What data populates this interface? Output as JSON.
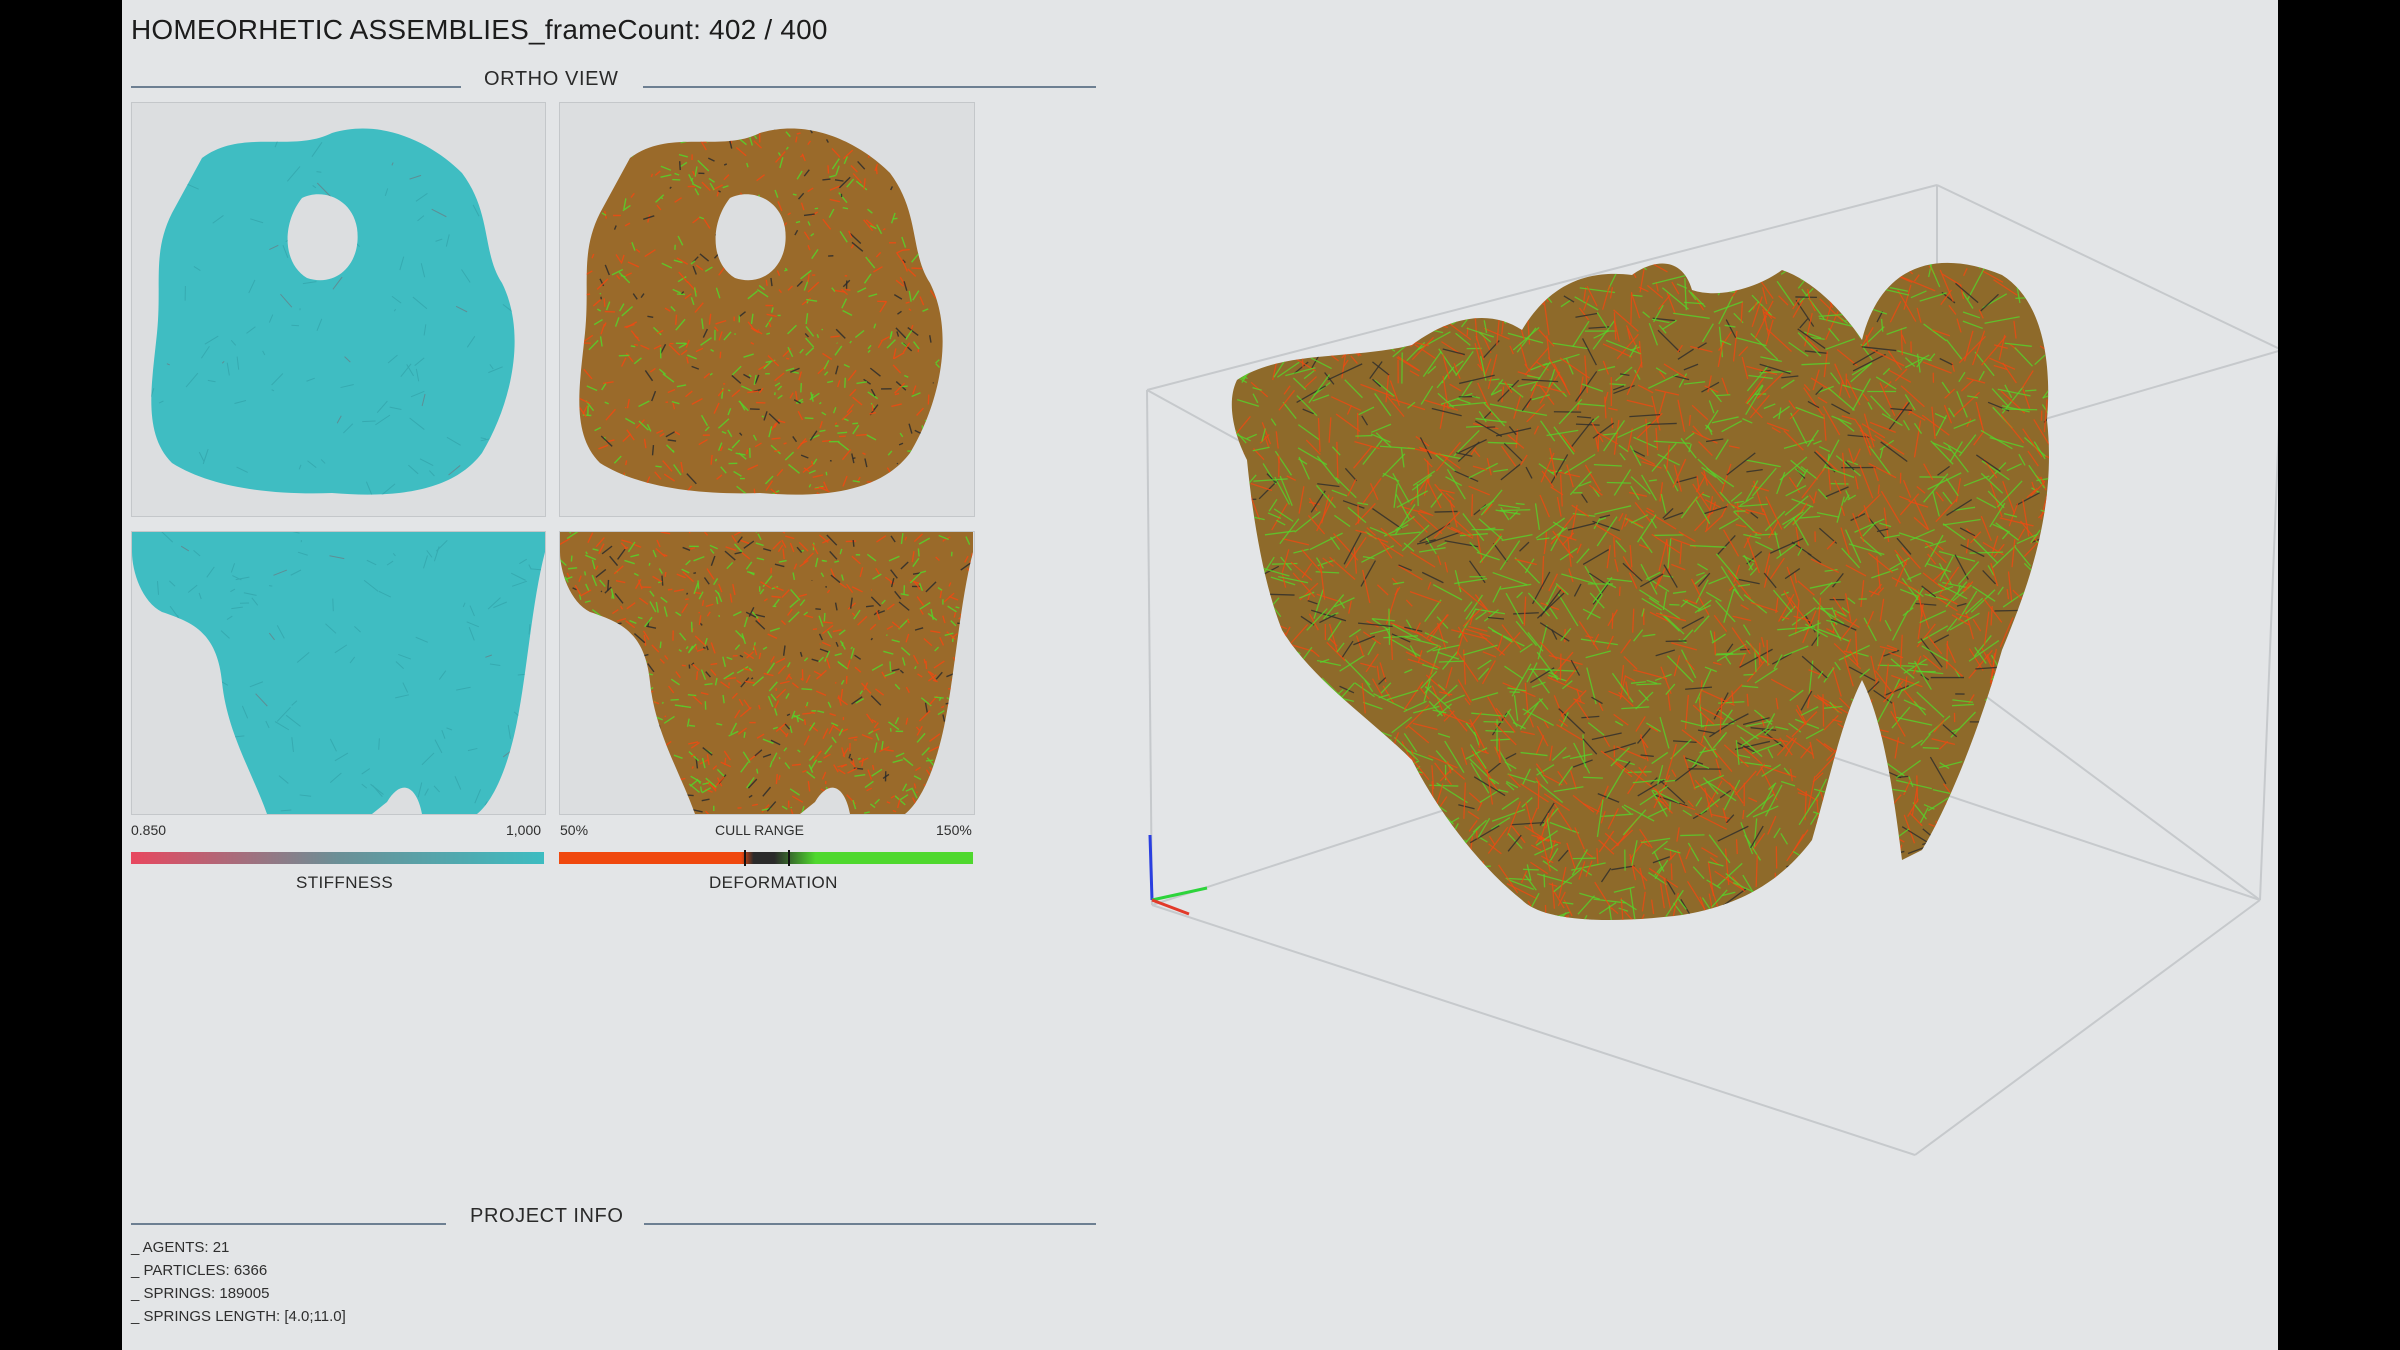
{
  "window": {
    "title": "HOMEORHETIC ASSEMBLIES_frameCount: 402 / 400"
  },
  "ortho_view": {
    "heading": "ORTHO VIEW",
    "panels": [
      {
        "name": "stiffness-top-view",
        "palette": "cyan"
      },
      {
        "name": "deformation-top-view",
        "palette": "red-green"
      },
      {
        "name": "stiffness-front-view",
        "palette": "cyan"
      },
      {
        "name": "deformation-front-view",
        "palette": "red-green"
      }
    ]
  },
  "stiffness": {
    "label": "STIFFNESS",
    "min_label": "0.850",
    "max_label": "1,000",
    "colors": [
      "#e8475f",
      "#6b8f96",
      "#3dbcc1"
    ]
  },
  "deformation": {
    "label": "DEFORMATION",
    "min_label": "50%",
    "mid_label": "CULL RANGE",
    "max_label": "150%",
    "colors": [
      "#f0480e",
      "#2a2a2a",
      "#4fd82e"
    ]
  },
  "project_info": {
    "heading": "PROJECT INFO",
    "lines": [
      "_ AGENTS: 21",
      "_ PARTICLES: 6366",
      "_ SPRINGS: 189005",
      "_ SPRINGS LENGTH: [4.0;11.0]"
    ]
  },
  "viewport_3d": {
    "axis_colors": {
      "x": "#e23a2a",
      "y": "#2dd43b",
      "z": "#2a3fe0"
    },
    "mesh_colors": [
      "#ef4a12",
      "#55d42a",
      "#2c2c2c"
    ]
  }
}
